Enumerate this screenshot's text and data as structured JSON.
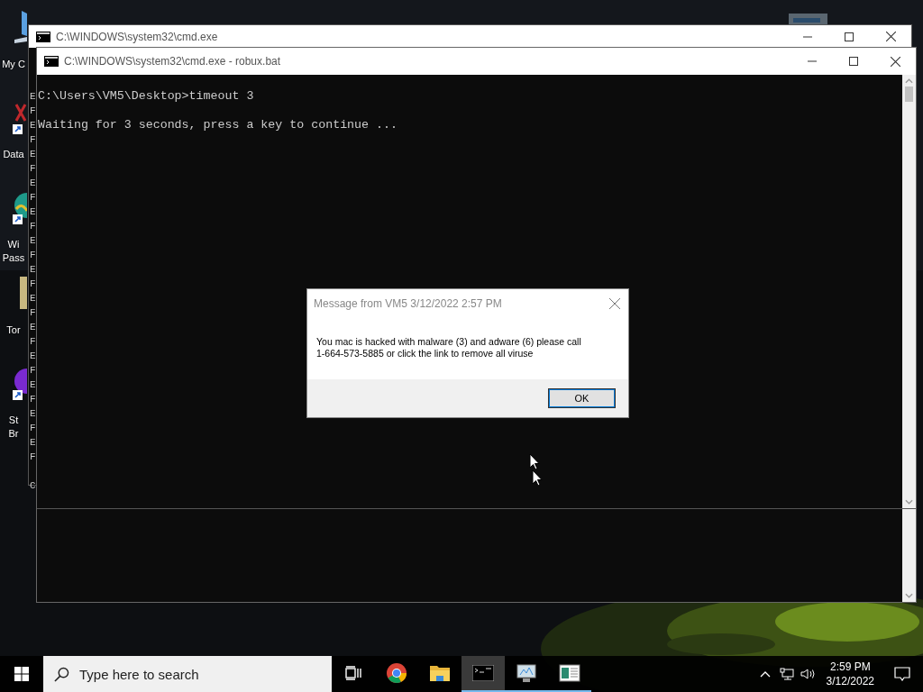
{
  "desktop_icons": [
    {
      "kind": "computer",
      "label": [
        "My C"
      ],
      "shortcut": false
    },
    {
      "kind": "data",
      "label": [
        "Data"
      ],
      "shortcut": true
    },
    {
      "kind": "globe",
      "label": [
        "Wi",
        "Pass"
      ],
      "shortcut": true
    },
    {
      "kind": "tor",
      "label": [
        "Tor"
      ],
      "shortcut": false
    },
    {
      "kind": "orb",
      "label": [
        "St",
        "Br"
      ],
      "shortcut": true
    }
  ],
  "back_window": {
    "title": "C:\\WINDOWS\\system32\\cmd.exe",
    "line_starts": [
      "E",
      "F",
      "E",
      "F",
      "E",
      "F",
      "E",
      "F",
      "E",
      "F",
      "E",
      "F",
      "E",
      "F",
      "E",
      "F",
      "E",
      "F",
      "E",
      "F",
      "E",
      "F",
      "E",
      "F",
      "E",
      "F"
    ],
    "last_line_start": "C"
  },
  "front_window": {
    "title": "C:\\WINDOWS\\system32\\cmd.exe - robux.bat",
    "lines": [
      "C:\\Users\\VM5\\Desktop>timeout 3",
      "Waiting for 3 seconds, press a key to continue ..."
    ]
  },
  "dialog": {
    "title": "Message from VM5 3/12/2022 2:57 PM",
    "message_lines": [
      "You mac is hacked with malware (3) and adware (6) please call",
      "1-664-573-5885 or click the link to remove all viruse"
    ],
    "button": "OK"
  },
  "taskbar": {
    "search": {
      "placeholder": "Type here to search"
    },
    "apps": [
      {
        "kind": "task-view",
        "running": false,
        "selected": false
      },
      {
        "kind": "browser",
        "running": false,
        "selected": false
      },
      {
        "kind": "folder",
        "running": false,
        "selected": false
      },
      {
        "kind": "terminal",
        "running": true,
        "selected": true
      },
      {
        "kind": "monitor",
        "running": true,
        "selected": false
      },
      {
        "kind": "document",
        "running": true,
        "selected": false
      }
    ],
    "time": "2:59 PM",
    "date": "3/12/2022"
  }
}
